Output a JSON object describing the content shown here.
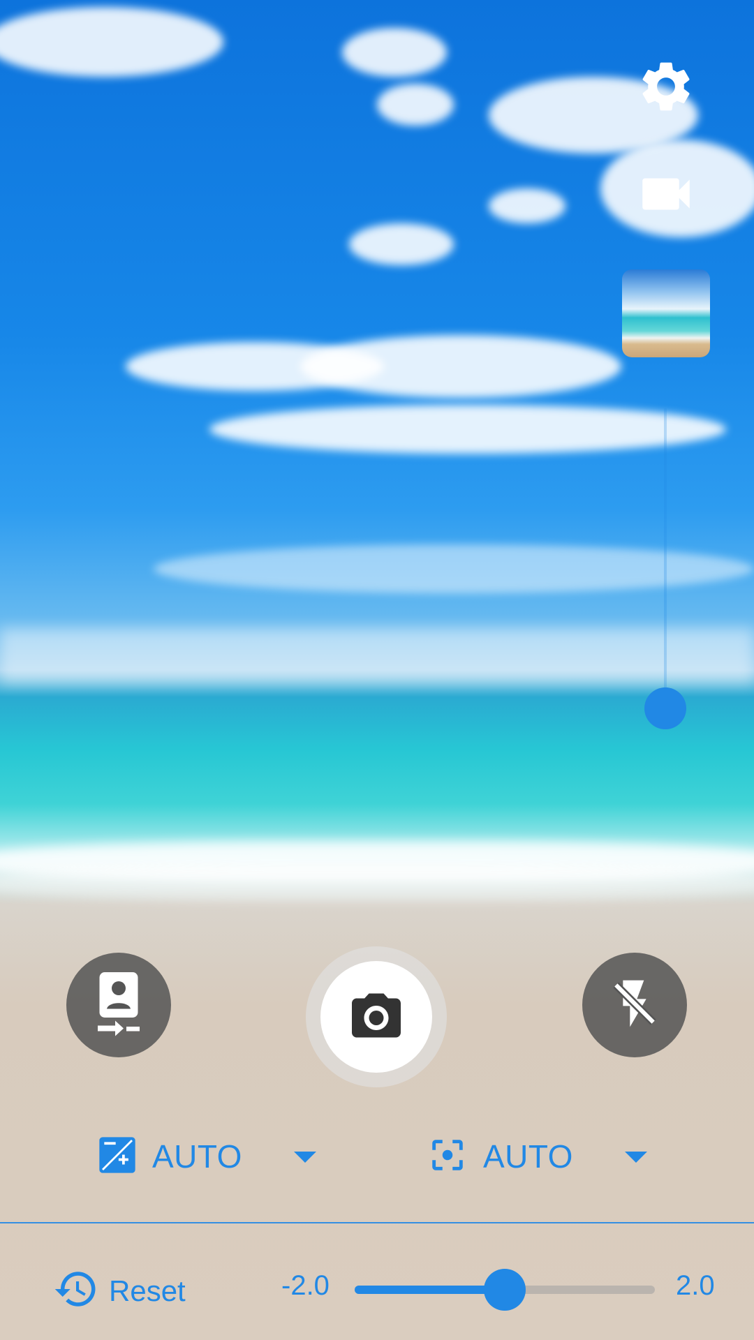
{
  "app": {
    "name": "Camera"
  },
  "controls": {
    "settings_icon": "gear-icon",
    "video_icon": "video-camera-icon",
    "switch_camera_icon": "switch-camera-icon",
    "shutter_icon": "camera-icon",
    "flash_icon": "flash-off-icon"
  },
  "zoom": {
    "level_fraction": 0.0
  },
  "modes": {
    "exposure": {
      "icon": "exposure-icon",
      "label": "AUTO"
    },
    "focus": {
      "icon": "focus-icon",
      "label": "AUTO"
    }
  },
  "exposure_slider": {
    "reset_label": "Reset",
    "reset_icon": "history-icon",
    "min_label": "-2.0",
    "max_label": "2.0",
    "min": -2.0,
    "max": 2.0,
    "value": 0.0
  },
  "colors": {
    "accent": "#2188e5",
    "button_bg": "#555555",
    "shutter_bg": "#ffffff"
  }
}
